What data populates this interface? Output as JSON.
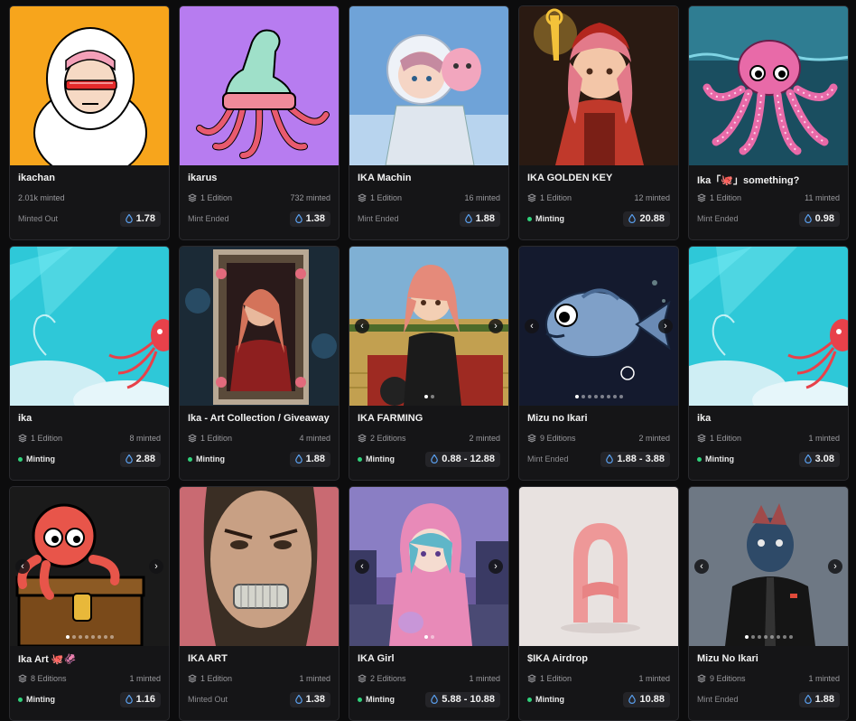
{
  "cards": [
    {
      "title": "ikachan",
      "editions": "",
      "minted": "2.01k minted",
      "status": "Minted Out",
      "live": false,
      "price": "1.78",
      "art": "yeti",
      "bg": "#f7a51c"
    },
    {
      "title": "ikarus",
      "editions": "1 Edition",
      "minted": "732 minted",
      "status": "Mint Ended",
      "live": false,
      "price": "1.38",
      "art": "ikarus",
      "bg": "#b77cf0"
    },
    {
      "title": "IKA Machin",
      "editions": "1 Edition",
      "minted": "16 minted",
      "status": "Mint Ended",
      "live": false,
      "price": "1.88",
      "art": "machin",
      "bg": "#6fa3d8"
    },
    {
      "title": "IKA GOLDEN KEY",
      "editions": "1 Edition",
      "minted": "12 minted",
      "status": "Minting",
      "live": true,
      "price": "20.88",
      "art": "goldenkey",
      "bg": "#3a2414"
    },
    {
      "title": "Ika「🐙」something?",
      "editions": "1 Edition",
      "minted": "11 minted",
      "status": "Mint Ended",
      "live": false,
      "price": "0.98",
      "art": "pixelocto",
      "bg": "#1f5a6e"
    },
    {
      "title": "ika",
      "editions": "1 Edition",
      "minted": "8 minted",
      "status": "Minting",
      "live": true,
      "price": "2.88",
      "art": "squid",
      "bg": "#2ec8d8"
    },
    {
      "title": "Ika - Art Collection / Giveaway",
      "editions": "1 Edition",
      "minted": "4 minted",
      "status": "Minting",
      "live": true,
      "price": "1.88",
      "art": "portrait",
      "bg": "#1b2a36"
    },
    {
      "title": "IKA FARMING",
      "editions": "2 Editions",
      "minted": "2 minted",
      "status": "Minting",
      "live": true,
      "price": "0.88 - 12.88",
      "art": "farming",
      "bg": "#8c7a3e",
      "carousel": 2
    },
    {
      "title": "Mizu no Ikari",
      "editions": "9 Editions",
      "minted": "2 minted",
      "status": "Mint Ended",
      "live": false,
      "price": "1.88 - 3.88",
      "art": "fish",
      "bg": "#141a2e",
      "carousel": 8
    },
    {
      "title": "ika",
      "editions": "1 Edition",
      "minted": "1 minted",
      "status": "Minting",
      "live": true,
      "price": "3.08",
      "art": "squid",
      "bg": "#2ec8d8"
    },
    {
      "title": "Ika Art 🐙🦑",
      "editions": "8 Editions",
      "minted": "1 minted",
      "status": "Minting",
      "live": true,
      "price": "1.16",
      "art": "chest",
      "bg": "#1a1a1a",
      "carousel": 8
    },
    {
      "title": "IKA ART",
      "editions": "1 Edition",
      "minted": "1 minted",
      "status": "Minted Out",
      "live": false,
      "price": "1.38",
      "art": "grillz",
      "bg": "#3c3226"
    },
    {
      "title": "IKA Girl",
      "editions": "2 Editions",
      "minted": "1 minted",
      "status": "Minting",
      "live": true,
      "price": "5.88 - 10.88",
      "art": "hoodie",
      "bg": "#6a5a9c",
      "carousel": 2
    },
    {
      "title": "$IKA Airdrop",
      "editions": "1 Edition",
      "minted": "1 minted",
      "status": "Minting",
      "live": true,
      "price": "10.88",
      "art": "airdrop",
      "bg": "#e8e2e0"
    },
    {
      "title": "Mizu No Ikari",
      "editions": "9 Editions",
      "minted": "1 minted",
      "status": "Mint Ended",
      "live": false,
      "price": "1.88",
      "art": "fishman",
      "bg": "#5b6673",
      "carousel": 8
    }
  ]
}
